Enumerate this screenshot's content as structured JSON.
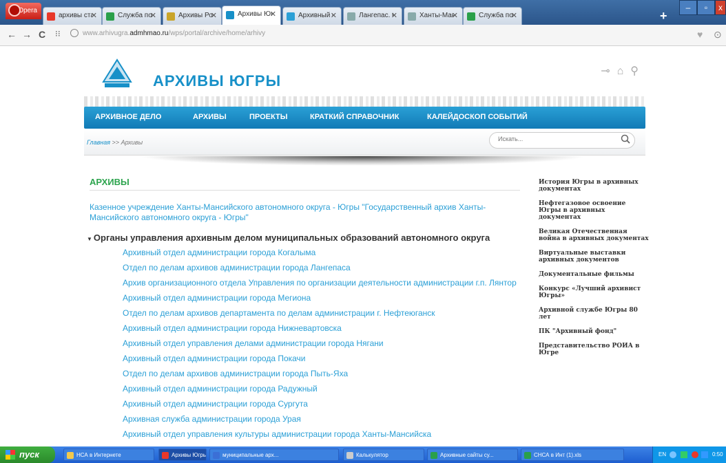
{
  "browser": {
    "menu_label": "Opera",
    "tabs": [
      {
        "label": "архивы старо...",
        "icon": "yandex-icon",
        "color": "#e8382a"
      },
      {
        "label": "Служба по де...",
        "icon": "site-icon",
        "color": "#2aa04a"
      },
      {
        "label": "Архивы Росси...",
        "icon": "site-icon",
        "color": "#c9a52a"
      },
      {
        "label": "Архивы Югры: ...",
        "icon": "site-icon",
        "color": "#1790c8"
      },
      {
        "label": "Архивный отд...",
        "icon": "site-icon",
        "color": "#2a9fd6"
      },
      {
        "label": "Лангепас. Офи...",
        "icon": "page-icon",
        "color": "#8aa"
      },
      {
        "label": "Ханты-Мансийс...",
        "icon": "page-icon",
        "color": "#8aa"
      },
      {
        "label": "Служба по де...",
        "icon": "site-icon",
        "color": "#2aa04a"
      }
    ],
    "new_tab": "+",
    "url_host": "www.arhivugra.",
    "url_domain": "admhmao.ru",
    "url_path": "/wps/portal/archive/home/arhivy"
  },
  "header": {
    "title": "АРХИВЫ ЮГРЫ",
    "nav": [
      "АРХИВНОЕ ДЕЛО",
      "АРХИВЫ",
      "ПРОЕКТЫ",
      "КРАТКИЙ СПРАВОЧНИК",
      "КАЛЕЙДОСКОП СОБЫТИЙ"
    ],
    "breadcrumb_home": "Главная",
    "breadcrumb_sep": " >> ",
    "breadcrumb_current": "Архивы",
    "search_placeholder": "Искать..."
  },
  "main": {
    "heading": "АРХИВЫ",
    "state_archive": "Казенное учреждение Ханты-Мансийского автономного округа - Югры \"Государственный архив Ханты-Мансийского автономного округа - Югры\"",
    "group_title": "Органы управления архивным делом муниципальных образований автономного округа",
    "items": [
      "Архивный отдел администрации города Когалыма",
      "Отдел по делам архивов администрации города Лангепаса",
      "Архив организационного отдела Управления по организации деятельности администрации г.п. Лянтор",
      "Архивный отдел администрации города Мегиона",
      "Отдел по делам архивов департамента по делам администрации г. Нефтеюганск",
      "Архивный отдел администрации города Нижневартовска",
      "Архивный отдел управления делами администрации города Нягани",
      "Архивный отдел администрации города Покачи",
      "Отдел по делам архивов администрации города Пыть-Яха",
      "Архивный отдел администрации города Радужный",
      "Архивный отдел администрации города Сургута",
      "Архивная служба администрации города Урая",
      "Архивный отдел управления культуры администрации города Ханты-Мансийска"
    ]
  },
  "sidebar": {
    "links": [
      "История Югры в архивных документах",
      "Нефтегазовое освоение Югры в архивных документах",
      "Великая Отечественная война в архивных документах",
      "Виртуальные выставки архивных документов",
      "Документальные фильмы",
      "Конкурс «Лучший архивист Югры»",
      "Архивной службе Югры 80 лет",
      "ПК \"Архивный фонд\"",
      "Представительство РОИА в Югре"
    ]
  },
  "taskbar": {
    "start_label": "пуск",
    "items": [
      {
        "label": "НСА в Интернете",
        "color": "#f2c94c"
      },
      {
        "label": "Архивы Югры: Архи...",
        "color": "#e8382a"
      },
      {
        "label": "муниципальные арх...",
        "color": "#3b6fd6"
      },
      {
        "label": "Калькулятор",
        "color": "#ccc"
      },
      {
        "label": "Архивные сайты су...",
        "color": "#2aa04a"
      },
      {
        "label": "СНСА в Инт (1).xls",
        "color": "#2aa04a"
      }
    ],
    "language": "EN",
    "clock": "0:50"
  }
}
